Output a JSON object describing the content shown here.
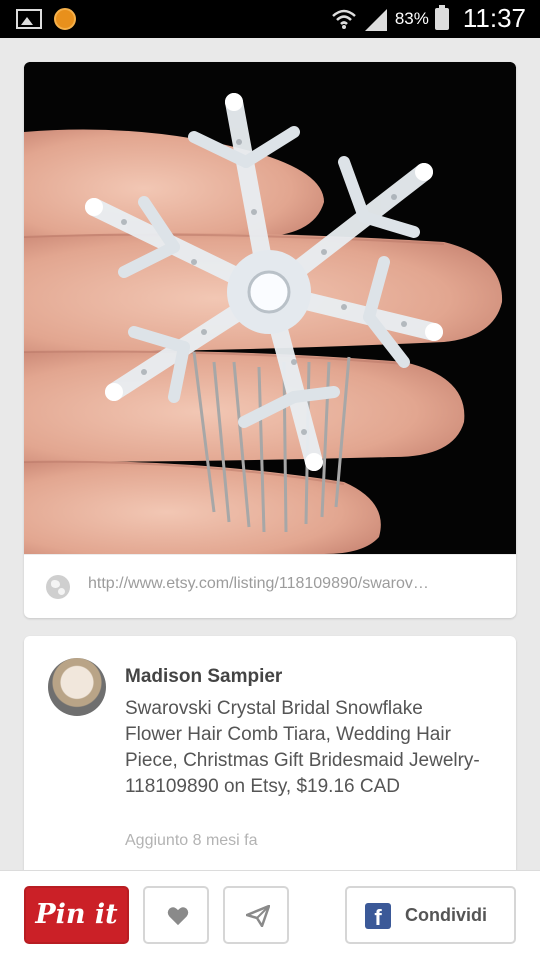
{
  "status_bar": {
    "battery": "83%",
    "time": "11:37"
  },
  "pin": {
    "source_url": "http://www.etsy.com/listing/118109890/swarov…",
    "pinner_name": "Madison Sampier",
    "description": "Swarovski Crystal Bridal Snowflake Flower Hair Comb Tiara, Wedding Hair Piece, Christmas Gift Bridesmaid Jewelry-118109890 on Etsy, $19.16 CAD",
    "added": "Aggiunto 8 mesi fa"
  },
  "actions": {
    "pin_it_label": "Pin it",
    "share_label": "Condividi"
  },
  "icons": {
    "like": "heart-icon",
    "send": "send-icon",
    "facebook": "facebook-icon",
    "source": "globe-icon"
  },
  "colors": {
    "pin_it": "#cb2027",
    "facebook": "#3b5998"
  }
}
